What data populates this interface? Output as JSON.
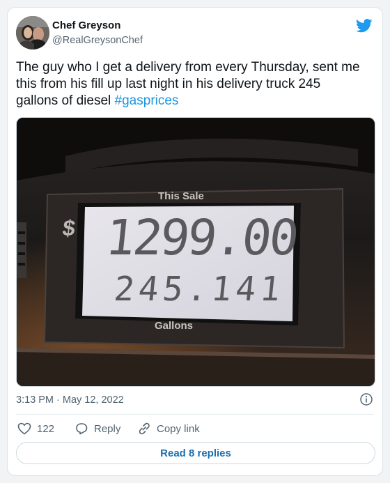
{
  "author": {
    "name": "Chef Greyson",
    "handle": "@RealGreysonChef"
  },
  "tweet": {
    "text": "The guy who I get a delivery from every Thursday,  sent me this from his fill up last night in his delivery truck 245 gallons of diesel ",
    "hashtag": "#gasprices",
    "timestamp": "3:13 PM · May 12, 2022"
  },
  "photo": {
    "top_label": "This Sale",
    "currency_symbol": "$",
    "sale_amount": "1299.00",
    "gallons": "245.141",
    "bottom_label": "Gallons"
  },
  "actions": {
    "likes": "122",
    "reply_label": "Reply",
    "copy_label": "Copy link",
    "read_replies": "Read 8 replies"
  },
  "colors": {
    "accent": "#1b95e0",
    "read_button_text": "#1b6fb0"
  },
  "icons": [
    "twitter-bird-icon",
    "info-icon",
    "heart-icon",
    "reply-icon",
    "link-icon"
  ]
}
